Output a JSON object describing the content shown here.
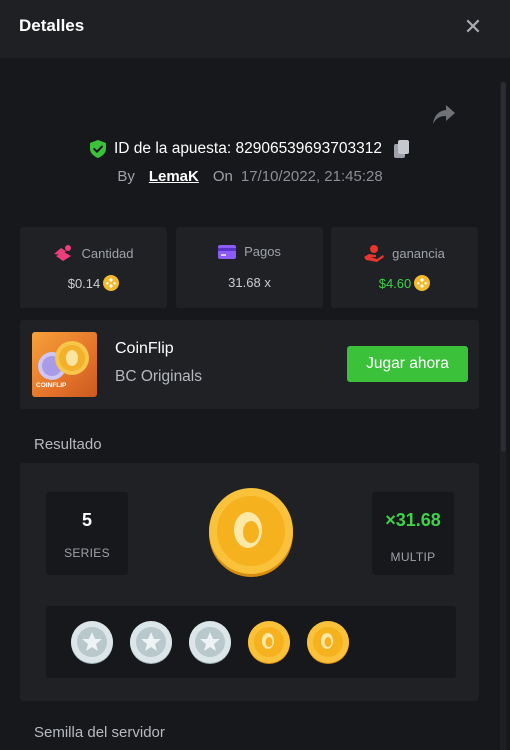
{
  "header": {
    "title": "Detalles",
    "close_glyph": "✕"
  },
  "bet": {
    "id_label": "ID de la apuesta: 82906539693703312",
    "by_label": "By",
    "user": "LemaK",
    "on_label": "On",
    "date": "17/10/2022, 21:45:28"
  },
  "stats": [
    {
      "label": "Cantidad",
      "value": "$0.14",
      "icon": "bet-amount-icon",
      "color": "#ec3f7a",
      "value_color": "#c9ccd0",
      "coin": true
    },
    {
      "label": "Pagos",
      "value": "31.68 x",
      "icon": "card-icon",
      "color": "#8b5cf6",
      "value_color": "#c9ccd0",
      "coin": false
    },
    {
      "label": "ganancia",
      "value": "$4.60",
      "icon": "profit-icon",
      "color": "#e8352e",
      "value_color": "#3ed24a",
      "coin": true
    }
  ],
  "game": {
    "title": "CoinFlip",
    "provider": "BC Originals",
    "thumb_text": "COINFLIP",
    "play_label": "Jugar ahora"
  },
  "result": {
    "section_label": "Resultado",
    "series_value": "5",
    "series_label": "SERIES",
    "multip_value": "×31.68",
    "multip_label": "MULTIP",
    "history": [
      "silver",
      "silver",
      "silver",
      "gold",
      "gold"
    ]
  },
  "seed": {
    "section_label": "Semilla del servidor"
  },
  "colors": {
    "background": "#17181b",
    "card": "#1f2125",
    "accent_green": "#3bc13a",
    "gold": "#f2b62b",
    "silver": "#c9d6d8"
  }
}
